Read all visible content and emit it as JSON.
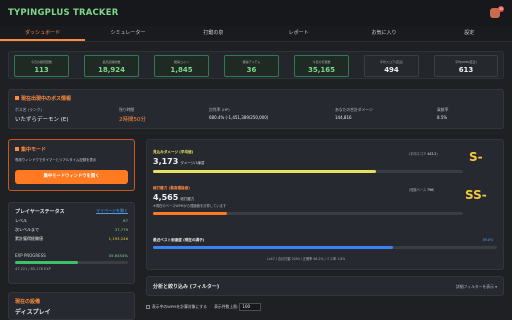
{
  "app": {
    "title": "TYPINGPLUS TRACKER",
    "badge": "30"
  },
  "tabs": [
    "ダッシュボード",
    "シミュレーター",
    "打鍵の泉",
    "レポート",
    "お気に入り",
    "設定"
  ],
  "stats": [
    {
      "label": "今日の練習回数",
      "value": "113"
    },
    {
      "label": "最高記録総数",
      "value": "18,924"
    },
    {
      "label": "獲得コイン",
      "value": "1,845"
    },
    {
      "label": "獲得アイテム",
      "value": "36"
    },
    {
      "label": "今日の打鍵数",
      "value": "35,165"
    },
    {
      "label": "平均スコア(直近)",
      "value": "494"
    },
    {
      "label": "平均WPM(直近)",
      "value": "613"
    }
  ],
  "boss": {
    "title": "現在出現中のボス情報",
    "name_label": "ボス名 (ランク)",
    "name_value": "いたずらデーモン (E)",
    "time_label": "残り時間",
    "time_value": "2時間50分",
    "hp_label": "討伐率 (HP)",
    "hp_value": "680.4% (-1,451,389/250,000)",
    "dmg_label": "あなたの合計ダメージ",
    "dmg_value": "144,816",
    "contrib_label": "貢献率",
    "contrib_value": "8.5%"
  },
  "focus": {
    "title": "集中モード",
    "desc": "専用ウィンドウでタイマーとリアルタイム記録を表示",
    "button": "集中モードウィンドウを開く"
  },
  "player": {
    "title": "プレイヤーステータス",
    "link": "マイページを開く",
    "rows": [
      {
        "label": "レベル",
        "value": "67"
      },
      {
        "label": "次レベルまで",
        "value": "37,779"
      },
      {
        "label": "累計獲得経験値",
        "value": "1,193,246"
      }
    ],
    "exp_label": "EXP PROGRESS",
    "exp_pct_text": "55.6454%",
    "exp_fraction": 0.556,
    "exp_text": "47,221 / 85,178 EXP"
  },
  "recent": {
    "title": "現在の設備",
    "sub": "ディスプレイ"
  },
  "metrics": {
    "m1": {
      "name": "見込みダメージ (平均値)",
      "value": "3,173",
      "unit": "ダメージ/1練習",
      "side_label": "(平均スコア",
      "side_value": "443.2",
      "rank": "S-",
      "fraction": 0.72,
      "color": "#e8e05a"
    },
    "m2": {
      "name": "総打鍵力 (最高理論値)",
      "value": "4,565",
      "unit": "総打鍵力",
      "note": "※現在のベースWPMから理論値を計算しています",
      "side_label": "(理論ベース",
      "side_value": "796",
      "rank": "SS-",
      "fraction": 0.24,
      "color": "#ff7a21"
    },
    "m3": {
      "name": "最近ベスト到達度 (現在の調子)",
      "pct": "69.8%",
      "fraction": 0.698,
      "color": "#3b82f6",
      "footer": "Lv47 / 合計打鍵 2050 / 正確率 98.2% / ミス率 1.8%"
    }
  },
  "filter": {
    "title": "分析と絞り込み (フィルター)",
    "detail": "詳細フィルターを表示"
  },
  "bottom": {
    "checkbox_label": "表示中のWPMを計算対象にする",
    "limit_label": "表示件数上限:",
    "limit_value": "100"
  }
}
